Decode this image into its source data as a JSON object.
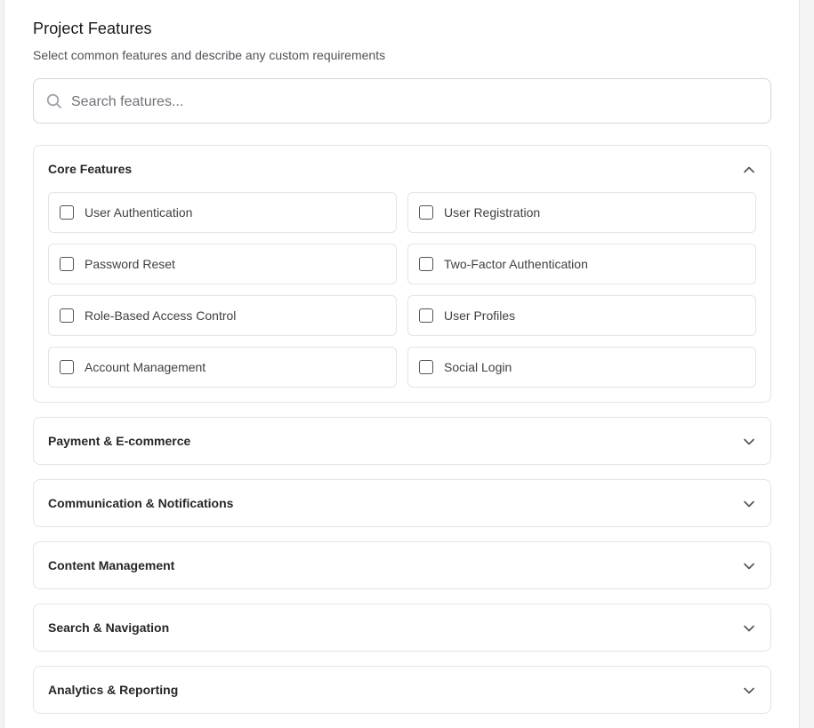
{
  "header": {
    "title": "Project Features",
    "subtitle": "Select common features and describe any custom requirements"
  },
  "search": {
    "placeholder": "Search features...",
    "value": "",
    "icon": "search-icon"
  },
  "sections": [
    {
      "label": "Core Features",
      "expanded": true,
      "chevron": "chevron-up-icon",
      "options": [
        {
          "label": "User Authentication",
          "checked": false
        },
        {
          "label": "User Registration",
          "checked": false
        },
        {
          "label": "Password Reset",
          "checked": false
        },
        {
          "label": "Two-Factor Authentication",
          "checked": false
        },
        {
          "label": "Role-Based Access Control",
          "checked": false
        },
        {
          "label": "User Profiles",
          "checked": false
        },
        {
          "label": "Account Management",
          "checked": false
        },
        {
          "label": "Social Login",
          "checked": false
        }
      ]
    },
    {
      "label": "Payment & E-commerce",
      "expanded": false,
      "chevron": "chevron-down-icon"
    },
    {
      "label": "Communication & Notifications",
      "expanded": false,
      "chevron": "chevron-down-icon"
    },
    {
      "label": "Content Management",
      "expanded": false,
      "chevron": "chevron-down-icon"
    },
    {
      "label": "Search & Navigation",
      "expanded": false,
      "chevron": "chevron-down-icon"
    },
    {
      "label": "Analytics & Reporting",
      "expanded": false,
      "chevron": "chevron-down-icon"
    }
  ]
}
